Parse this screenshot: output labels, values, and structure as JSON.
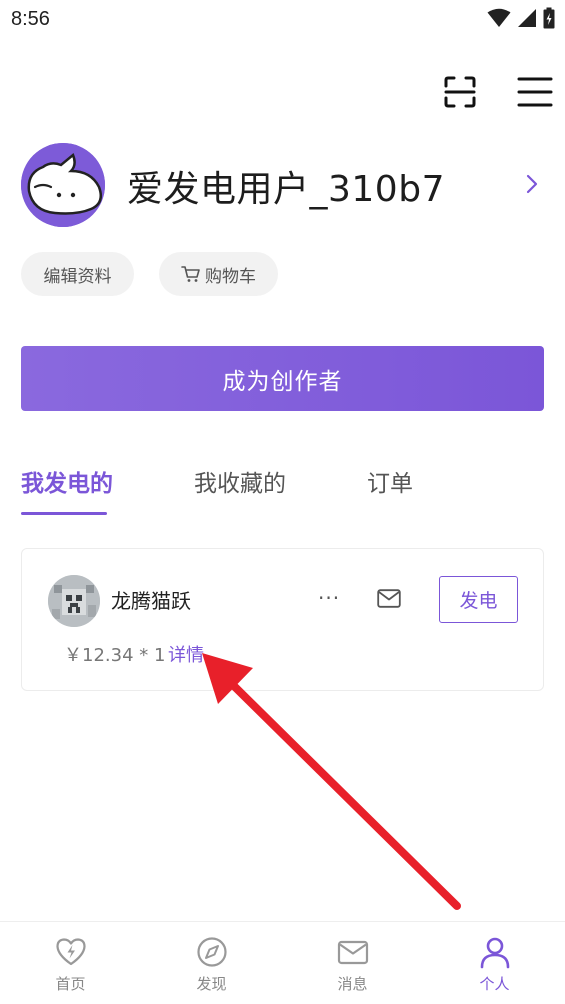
{
  "status_bar": {
    "time": "8:56"
  },
  "profile": {
    "username": "爱发电用户_310b7",
    "edit_profile_label": "编辑资料",
    "cart_label": "购物车"
  },
  "cta": {
    "become_creator_label": "成为创作者"
  },
  "tabs": [
    {
      "label": "我发电的",
      "active": true
    },
    {
      "label": "我收藏的",
      "active": false
    },
    {
      "label": "订单",
      "active": false
    }
  ],
  "sponsored": [
    {
      "name": "龙腾猫跃",
      "more_label": "···",
      "action_label": "发电",
      "price": "￥12.34 * 1",
      "detail_label": "详情"
    }
  ],
  "bottom_nav": [
    {
      "label": "首页",
      "icon": "heart-bolt-icon",
      "active": false
    },
    {
      "label": "发现",
      "icon": "compass-icon",
      "active": false
    },
    {
      "label": "消息",
      "icon": "mail-icon",
      "active": false
    },
    {
      "label": "个人",
      "icon": "person-icon",
      "active": true
    }
  ],
  "colors": {
    "accent": "#7b56d8",
    "annotation_arrow": "#e8202a"
  }
}
